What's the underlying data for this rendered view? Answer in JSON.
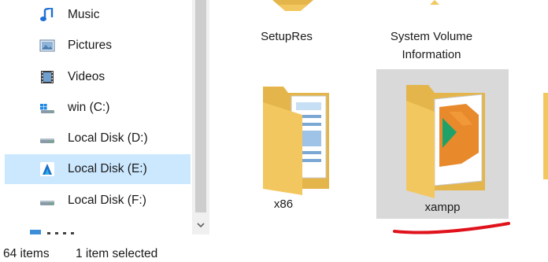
{
  "navigation": {
    "items": [
      {
        "label": "Music",
        "icon": "music-note-icon"
      },
      {
        "label": "Pictures",
        "icon": "pictures-icon"
      },
      {
        "label": "Videos",
        "icon": "videos-icon"
      },
      {
        "label": "win (C:)",
        "icon": "windows-drive-icon"
      },
      {
        "label": "Local Disk (D:)",
        "icon": "drive-icon"
      },
      {
        "label": "Local Disk (E:)",
        "icon": "drive-icon",
        "selected": true
      },
      {
        "label": "Local Disk (F:)",
        "icon": "drive-icon"
      }
    ]
  },
  "content": {
    "folders": [
      {
        "name": "SetupRes"
      },
      {
        "name": "System Volume Information"
      },
      {
        "name": "x86"
      },
      {
        "name": "xampp",
        "selected": true
      }
    ]
  },
  "status_bar": {
    "item_count": "64 items",
    "selection": "1 item selected"
  },
  "colors": {
    "selected_nav": "#cce8ff",
    "selected_tile": "#d9d9d9",
    "folder_yellow": "#f3c75f",
    "annotation_red": "#e0121c"
  }
}
